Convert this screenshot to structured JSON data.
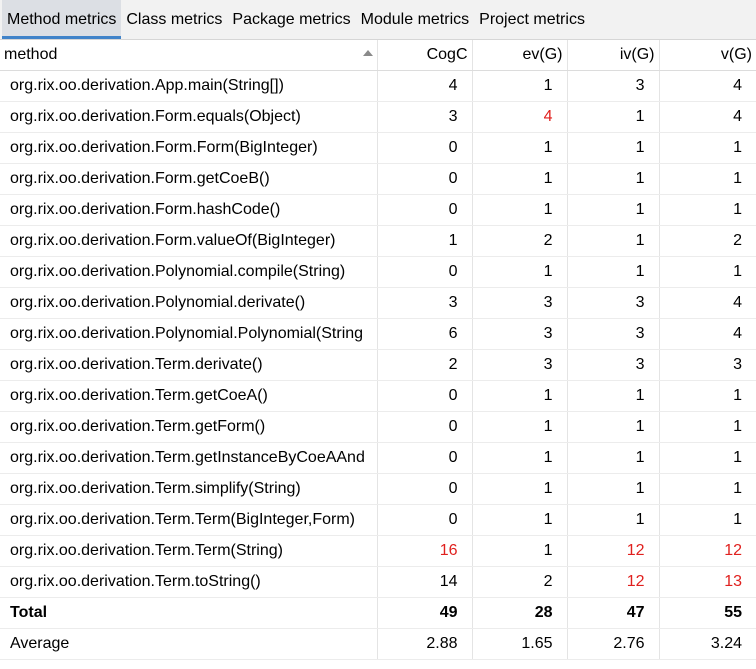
{
  "tabs": [
    {
      "label": "Method metrics",
      "active": true
    },
    {
      "label": "Class metrics",
      "active": false
    },
    {
      "label": "Package metrics",
      "active": false
    },
    {
      "label": "Module metrics",
      "active": false
    },
    {
      "label": "Project metrics",
      "active": false
    }
  ],
  "table": {
    "columns": [
      "method",
      "CogC",
      "ev(G)",
      "iv(G)",
      "v(G)"
    ],
    "sorted_column": "method",
    "sort_direction": "ascending",
    "rows": [
      {
        "method": "org.rix.oo.derivation.App.main(String[])",
        "values": [
          "4",
          "1",
          "3",
          "4"
        ],
        "red": [
          false,
          false,
          false,
          false
        ]
      },
      {
        "method": "org.rix.oo.derivation.Form.equals(Object)",
        "values": [
          "3",
          "4",
          "1",
          "4"
        ],
        "red": [
          false,
          true,
          false,
          false
        ]
      },
      {
        "method": "org.rix.oo.derivation.Form.Form(BigInteger)",
        "values": [
          "0",
          "1",
          "1",
          "1"
        ],
        "red": [
          false,
          false,
          false,
          false
        ]
      },
      {
        "method": "org.rix.oo.derivation.Form.getCoeB()",
        "values": [
          "0",
          "1",
          "1",
          "1"
        ],
        "red": [
          false,
          false,
          false,
          false
        ]
      },
      {
        "method": "org.rix.oo.derivation.Form.hashCode()",
        "values": [
          "0",
          "1",
          "1",
          "1"
        ],
        "red": [
          false,
          false,
          false,
          false
        ]
      },
      {
        "method": "org.rix.oo.derivation.Form.valueOf(BigInteger)",
        "values": [
          "1",
          "2",
          "1",
          "2"
        ],
        "red": [
          false,
          false,
          false,
          false
        ]
      },
      {
        "method": "org.rix.oo.derivation.Polynomial.compile(String)",
        "values": [
          "0",
          "1",
          "1",
          "1"
        ],
        "red": [
          false,
          false,
          false,
          false
        ]
      },
      {
        "method": "org.rix.oo.derivation.Polynomial.derivate()",
        "values": [
          "3",
          "3",
          "3",
          "4"
        ],
        "red": [
          false,
          false,
          false,
          false
        ]
      },
      {
        "method": "org.rix.oo.derivation.Polynomial.Polynomial(String",
        "values": [
          "6",
          "3",
          "3",
          "4"
        ],
        "red": [
          false,
          false,
          false,
          false
        ]
      },
      {
        "method": "org.rix.oo.derivation.Term.derivate()",
        "values": [
          "2",
          "3",
          "3",
          "3"
        ],
        "red": [
          false,
          false,
          false,
          false
        ]
      },
      {
        "method": "org.rix.oo.derivation.Term.getCoeA()",
        "values": [
          "0",
          "1",
          "1",
          "1"
        ],
        "red": [
          false,
          false,
          false,
          false
        ]
      },
      {
        "method": "org.rix.oo.derivation.Term.getForm()",
        "values": [
          "0",
          "1",
          "1",
          "1"
        ],
        "red": [
          false,
          false,
          false,
          false
        ]
      },
      {
        "method": "org.rix.oo.derivation.Term.getInstanceByCoeAAnd",
        "values": [
          "0",
          "1",
          "1",
          "1"
        ],
        "red": [
          false,
          false,
          false,
          false
        ]
      },
      {
        "method": "org.rix.oo.derivation.Term.simplify(String)",
        "values": [
          "0",
          "1",
          "1",
          "1"
        ],
        "red": [
          false,
          false,
          false,
          false
        ]
      },
      {
        "method": "org.rix.oo.derivation.Term.Term(BigInteger,Form)",
        "values": [
          "0",
          "1",
          "1",
          "1"
        ],
        "red": [
          false,
          false,
          false,
          false
        ]
      },
      {
        "method": "org.rix.oo.derivation.Term.Term(String)",
        "values": [
          "16",
          "1",
          "12",
          "12"
        ],
        "red": [
          true,
          false,
          true,
          true
        ]
      },
      {
        "method": "org.rix.oo.derivation.Term.toString()",
        "values": [
          "14",
          "2",
          "12",
          "13"
        ],
        "red": [
          false,
          false,
          true,
          true
        ]
      }
    ],
    "total": {
      "label": "Total",
      "values": [
        "49",
        "28",
        "47",
        "55"
      ]
    },
    "average": {
      "label": "Average",
      "values": [
        "2.88",
        "1.65",
        "2.76",
        "3.24"
      ]
    }
  },
  "colors": {
    "warning_value": "#e0201e",
    "active_tab_underline": "#4083c9"
  },
  "icons": {
    "sort_indicator": "sort-ascending-icon"
  }
}
